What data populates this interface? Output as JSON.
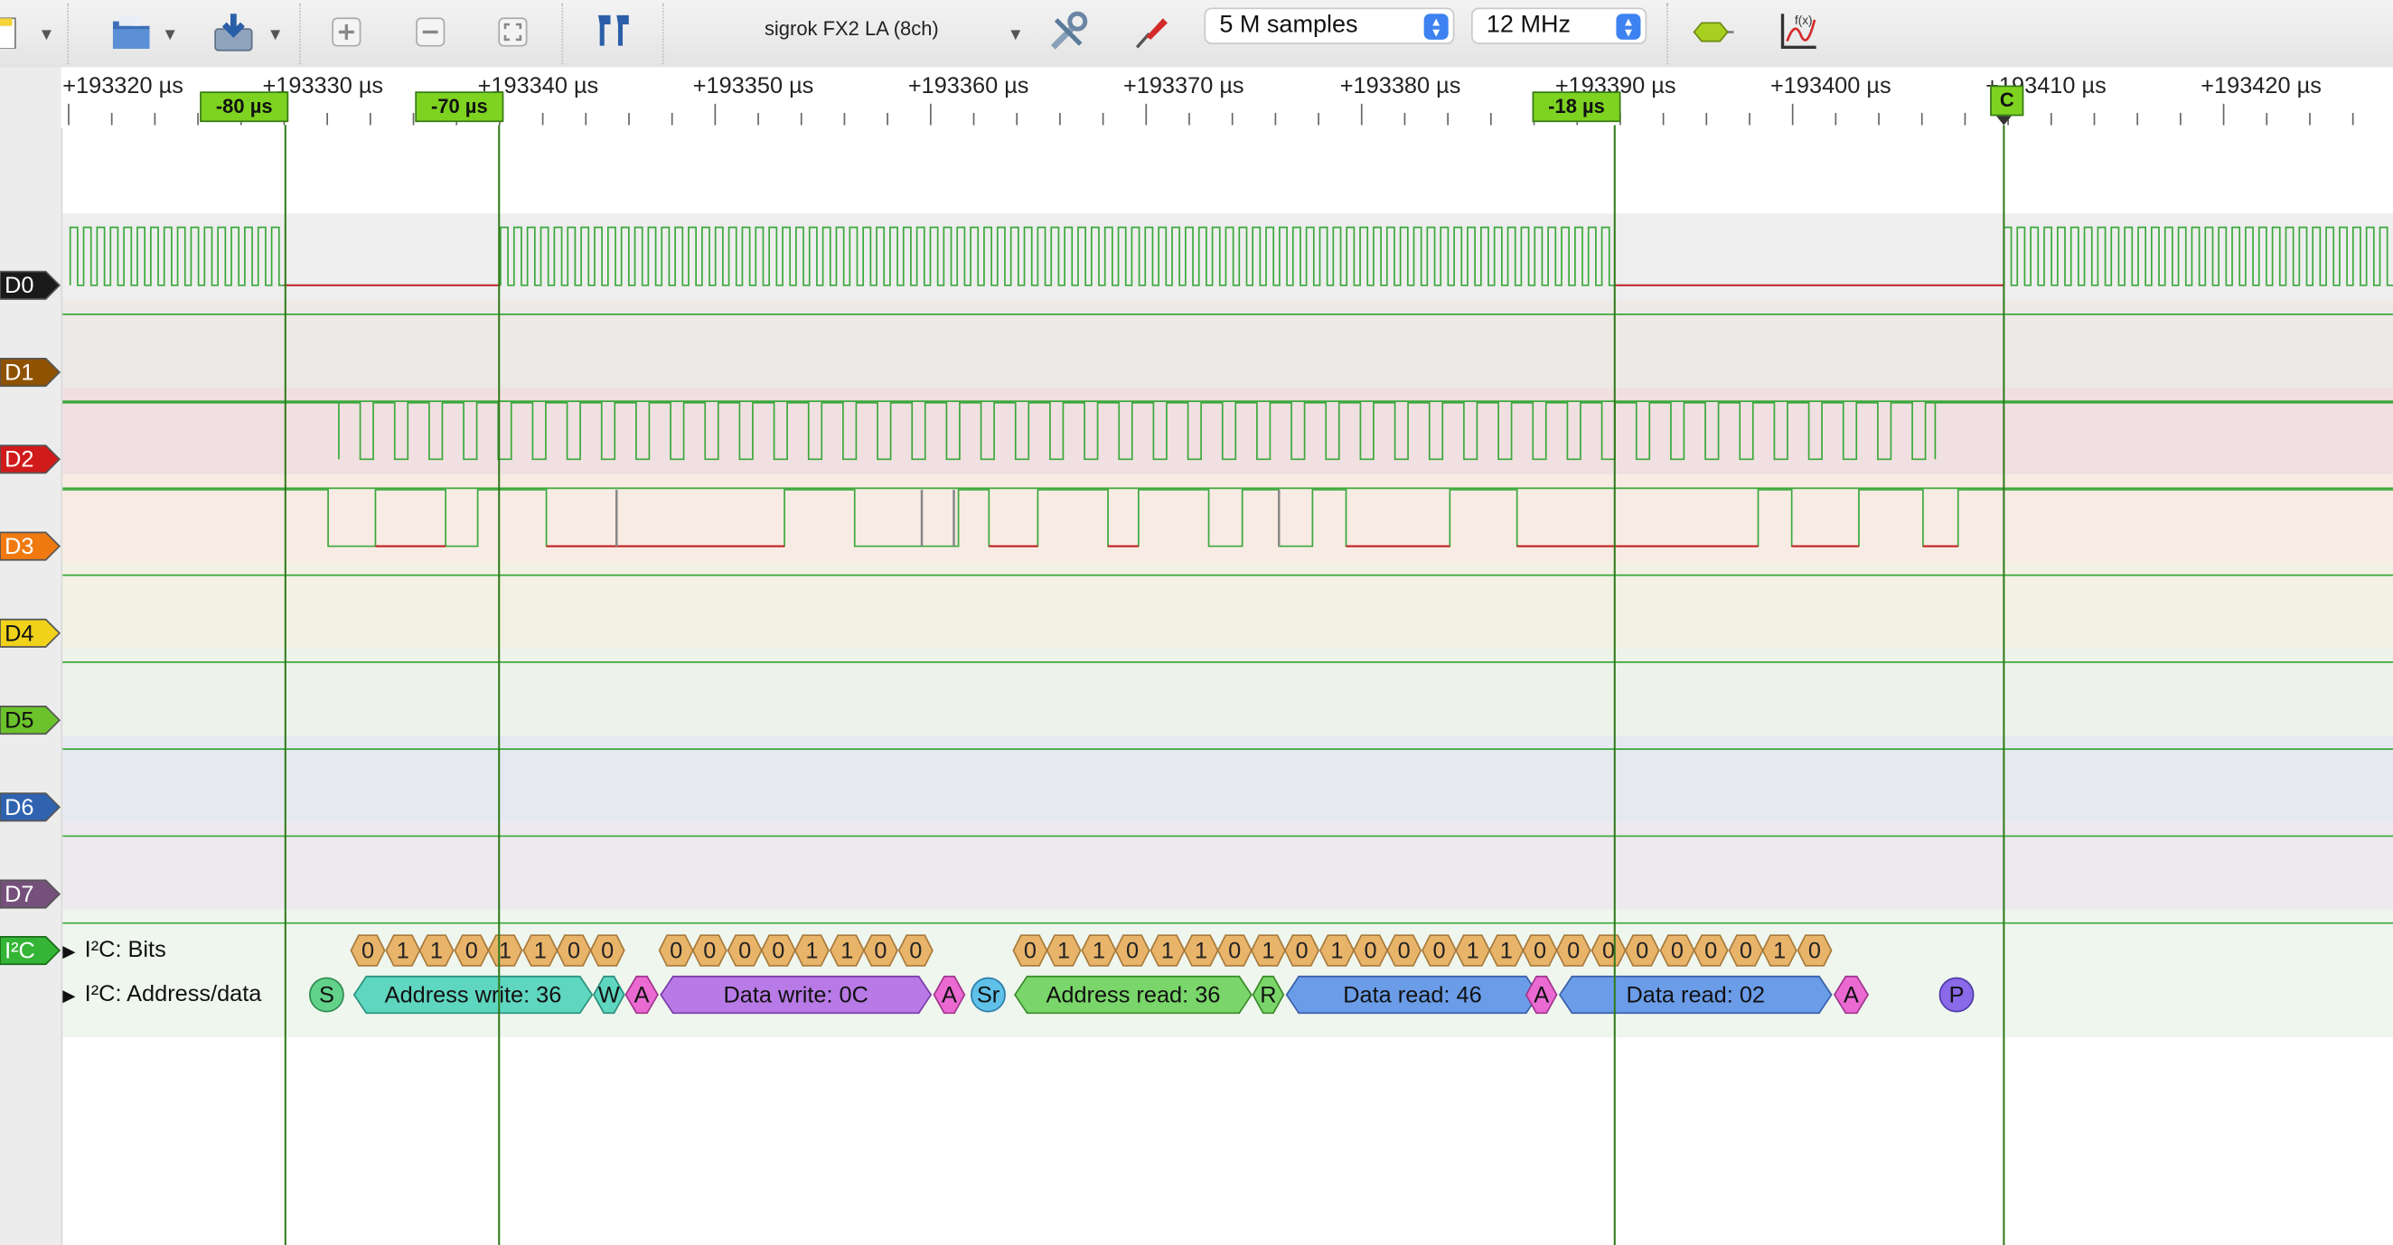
{
  "toolbar": {
    "device": "sigrok FX2 LA (8ch)",
    "samples": "5 M samples",
    "samplerate": "12 MHz"
  },
  "ruler": {
    "ticks": [
      "+193320 µs",
      "+193330 µs",
      "+193340 µs",
      "+193350 µs",
      "+193360 µs",
      "+193370 µs",
      "+193380 µs",
      "+193390 µs",
      "+193400 µs",
      "+193410 µs",
      "+193420 µs"
    ],
    "markers": [
      {
        "label": "-80 µs"
      },
      {
        "label": "-70 µs"
      },
      {
        "label": "-18 µs"
      },
      {
        "label": "C"
      }
    ]
  },
  "channels": [
    {
      "label": "D0",
      "color": "#1a1a1a",
      "text": "#ffffff"
    },
    {
      "label": "D1",
      "color": "#8f5200",
      "text": "#ffffff"
    },
    {
      "label": "D2",
      "color": "#d11a1a",
      "text": "#ffffff"
    },
    {
      "label": "D3",
      "color": "#f07a10",
      "text": "#ffffff"
    },
    {
      "label": "D4",
      "color": "#f0d21a",
      "text": "#111111"
    },
    {
      "label": "D5",
      "color": "#6cc22a",
      "text": "#111111"
    },
    {
      "label": "D6",
      "color": "#2f63b0",
      "text": "#ffffff"
    },
    {
      "label": "D7",
      "color": "#75507b",
      "text": "#ffffff"
    }
  ],
  "decoder": {
    "label": "I²C",
    "rows": [
      "I²C: Bits",
      "I²C: Address/data"
    ],
    "bits": [
      "0",
      "1",
      "1",
      "0",
      "1",
      "1",
      "0",
      "0",
      "0",
      "0",
      "0",
      "0",
      "1",
      "1",
      "0",
      "0",
      "0",
      "1",
      "1",
      "0",
      "1",
      "1",
      "0",
      "1",
      "0",
      "1",
      "0",
      "0",
      "0",
      "1",
      "1",
      "0",
      "0",
      "0",
      "0",
      "0",
      "0",
      "0",
      "1",
      "0"
    ],
    "annotations": [
      "S",
      "Address write: 36",
      "W",
      "A",
      "Data write: 0C",
      "A",
      "Sr",
      "Address read: 36",
      "R",
      "Data read: 46",
      "A",
      "Data read: 02",
      "A",
      "P"
    ]
  }
}
